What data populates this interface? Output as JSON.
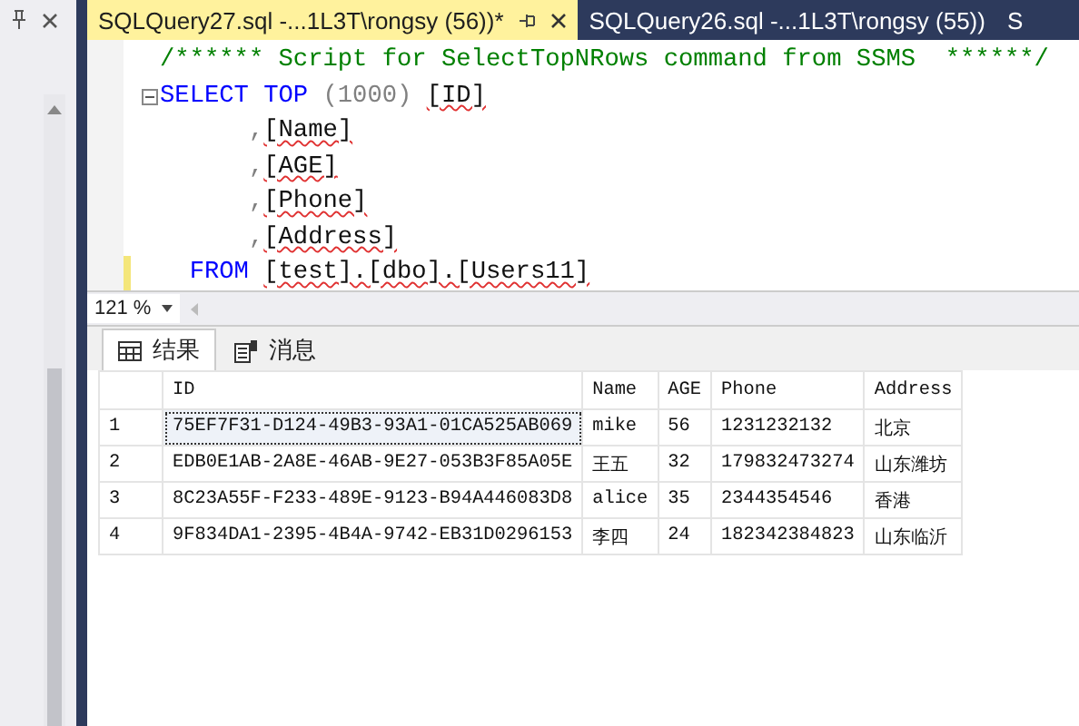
{
  "doc_tabs": [
    {
      "title": "SQLQuery27.sql -...1L3T\\rongsy (56))*",
      "selected": true
    },
    {
      "title": "SQLQuery26.sql -...1L3T\\rongsy (55))",
      "selected": false
    },
    {
      "title": "S",
      "selected": false
    }
  ],
  "editor": {
    "lines": [
      {
        "collapse": false,
        "modified": false,
        "tokens": [
          {
            "kind": "comment",
            "text": "/****** Script for SelectTopNRows command from SSMS  ******/"
          }
        ]
      },
      {
        "collapse": true,
        "modified": false,
        "tokens": [
          {
            "kind": "keyword",
            "text": "SELECT TOP"
          },
          {
            "kind": "plain",
            "text": " (1000) "
          },
          {
            "kind": "ident",
            "text": "[ID]"
          }
        ]
      },
      {
        "collapse": false,
        "modified": false,
        "tokens": [
          {
            "kind": "plain",
            "text": "      ,"
          },
          {
            "kind": "ident",
            "text": "[Name]"
          }
        ]
      },
      {
        "collapse": false,
        "modified": false,
        "tokens": [
          {
            "kind": "plain",
            "text": "      ,"
          },
          {
            "kind": "ident",
            "text": "[AGE]"
          }
        ]
      },
      {
        "collapse": false,
        "modified": false,
        "tokens": [
          {
            "kind": "plain",
            "text": "      ,"
          },
          {
            "kind": "ident",
            "text": "[Phone]"
          }
        ]
      },
      {
        "collapse": false,
        "modified": false,
        "tokens": [
          {
            "kind": "plain",
            "text": "      ,"
          },
          {
            "kind": "ident",
            "text": "[Address]"
          }
        ]
      },
      {
        "collapse": false,
        "modified": true,
        "tokens": [
          {
            "kind": "keyword",
            "text": "  FROM "
          },
          {
            "kind": "ident",
            "text": "[test].[dbo].[Users11]"
          }
        ]
      }
    ]
  },
  "zoom": {
    "value": "121 %"
  },
  "result_tabs": [
    {
      "label": "结果",
      "kind": "grid",
      "selected": true
    },
    {
      "label": "消息",
      "kind": "messages",
      "selected": false
    }
  ],
  "table": {
    "columns": [
      "ID",
      "Name",
      "AGE",
      "Phone",
      "Address"
    ],
    "rows": [
      {
        "number": "1",
        "selected": true,
        "cells": [
          "75EF7F31-D124-49B3-93A1-01CA525AB069",
          "mike",
          "56",
          "1231232132",
          "北京"
        ]
      },
      {
        "number": "2",
        "selected": false,
        "cells": [
          "EDB0E1AB-2A8E-46AB-9E27-053B3F85A05E",
          "王五",
          "32",
          "179832473274",
          "山东潍坊"
        ]
      },
      {
        "number": "3",
        "selected": false,
        "cells": [
          "8C23A55F-F233-489E-9123-B94A446083D8",
          "alice",
          "35",
          "2344354546",
          "香港"
        ]
      },
      {
        "number": "4",
        "selected": false,
        "cells": [
          "9F834DA1-2395-4B4A-9742-EB31D0296153",
          "李四",
          "24",
          "182342384823",
          "山东临沂"
        ]
      }
    ]
  }
}
